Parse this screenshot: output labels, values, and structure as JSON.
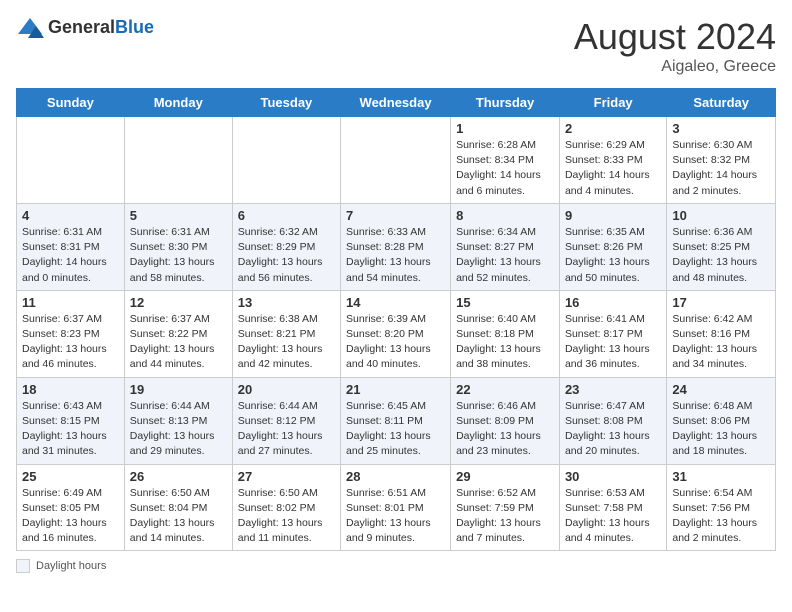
{
  "header": {
    "logo_general": "General",
    "logo_blue": "Blue",
    "title": "August 2024",
    "location": "Aigaleo, Greece"
  },
  "weekdays": [
    "Sunday",
    "Monday",
    "Tuesday",
    "Wednesday",
    "Thursday",
    "Friday",
    "Saturday"
  ],
  "weeks": [
    [
      {
        "day": "",
        "info": ""
      },
      {
        "day": "",
        "info": ""
      },
      {
        "day": "",
        "info": ""
      },
      {
        "day": "",
        "info": ""
      },
      {
        "day": "1",
        "info": "Sunrise: 6:28 AM\nSunset: 8:34 PM\nDaylight: 14 hours\nand 6 minutes."
      },
      {
        "day": "2",
        "info": "Sunrise: 6:29 AM\nSunset: 8:33 PM\nDaylight: 14 hours\nand 4 minutes."
      },
      {
        "day": "3",
        "info": "Sunrise: 6:30 AM\nSunset: 8:32 PM\nDaylight: 14 hours\nand 2 minutes."
      }
    ],
    [
      {
        "day": "4",
        "info": "Sunrise: 6:31 AM\nSunset: 8:31 PM\nDaylight: 14 hours\nand 0 minutes."
      },
      {
        "day": "5",
        "info": "Sunrise: 6:31 AM\nSunset: 8:30 PM\nDaylight: 13 hours\nand 58 minutes."
      },
      {
        "day": "6",
        "info": "Sunrise: 6:32 AM\nSunset: 8:29 PM\nDaylight: 13 hours\nand 56 minutes."
      },
      {
        "day": "7",
        "info": "Sunrise: 6:33 AM\nSunset: 8:28 PM\nDaylight: 13 hours\nand 54 minutes."
      },
      {
        "day": "8",
        "info": "Sunrise: 6:34 AM\nSunset: 8:27 PM\nDaylight: 13 hours\nand 52 minutes."
      },
      {
        "day": "9",
        "info": "Sunrise: 6:35 AM\nSunset: 8:26 PM\nDaylight: 13 hours\nand 50 minutes."
      },
      {
        "day": "10",
        "info": "Sunrise: 6:36 AM\nSunset: 8:25 PM\nDaylight: 13 hours\nand 48 minutes."
      }
    ],
    [
      {
        "day": "11",
        "info": "Sunrise: 6:37 AM\nSunset: 8:23 PM\nDaylight: 13 hours\nand 46 minutes."
      },
      {
        "day": "12",
        "info": "Sunrise: 6:37 AM\nSunset: 8:22 PM\nDaylight: 13 hours\nand 44 minutes."
      },
      {
        "day": "13",
        "info": "Sunrise: 6:38 AM\nSunset: 8:21 PM\nDaylight: 13 hours\nand 42 minutes."
      },
      {
        "day": "14",
        "info": "Sunrise: 6:39 AM\nSunset: 8:20 PM\nDaylight: 13 hours\nand 40 minutes."
      },
      {
        "day": "15",
        "info": "Sunrise: 6:40 AM\nSunset: 8:18 PM\nDaylight: 13 hours\nand 38 minutes."
      },
      {
        "day": "16",
        "info": "Sunrise: 6:41 AM\nSunset: 8:17 PM\nDaylight: 13 hours\nand 36 minutes."
      },
      {
        "day": "17",
        "info": "Sunrise: 6:42 AM\nSunset: 8:16 PM\nDaylight: 13 hours\nand 34 minutes."
      }
    ],
    [
      {
        "day": "18",
        "info": "Sunrise: 6:43 AM\nSunset: 8:15 PM\nDaylight: 13 hours\nand 31 minutes."
      },
      {
        "day": "19",
        "info": "Sunrise: 6:44 AM\nSunset: 8:13 PM\nDaylight: 13 hours\nand 29 minutes."
      },
      {
        "day": "20",
        "info": "Sunrise: 6:44 AM\nSunset: 8:12 PM\nDaylight: 13 hours\nand 27 minutes."
      },
      {
        "day": "21",
        "info": "Sunrise: 6:45 AM\nSunset: 8:11 PM\nDaylight: 13 hours\nand 25 minutes."
      },
      {
        "day": "22",
        "info": "Sunrise: 6:46 AM\nSunset: 8:09 PM\nDaylight: 13 hours\nand 23 minutes."
      },
      {
        "day": "23",
        "info": "Sunrise: 6:47 AM\nSunset: 8:08 PM\nDaylight: 13 hours\nand 20 minutes."
      },
      {
        "day": "24",
        "info": "Sunrise: 6:48 AM\nSunset: 8:06 PM\nDaylight: 13 hours\nand 18 minutes."
      }
    ],
    [
      {
        "day": "25",
        "info": "Sunrise: 6:49 AM\nSunset: 8:05 PM\nDaylight: 13 hours\nand 16 minutes."
      },
      {
        "day": "26",
        "info": "Sunrise: 6:50 AM\nSunset: 8:04 PM\nDaylight: 13 hours\nand 14 minutes."
      },
      {
        "day": "27",
        "info": "Sunrise: 6:50 AM\nSunset: 8:02 PM\nDaylight: 13 hours\nand 11 minutes."
      },
      {
        "day": "28",
        "info": "Sunrise: 6:51 AM\nSunset: 8:01 PM\nDaylight: 13 hours\nand 9 minutes."
      },
      {
        "day": "29",
        "info": "Sunrise: 6:52 AM\nSunset: 7:59 PM\nDaylight: 13 hours\nand 7 minutes."
      },
      {
        "day": "30",
        "info": "Sunrise: 6:53 AM\nSunset: 7:58 PM\nDaylight: 13 hours\nand 4 minutes."
      },
      {
        "day": "31",
        "info": "Sunrise: 6:54 AM\nSunset: 7:56 PM\nDaylight: 13 hours\nand 2 minutes."
      }
    ]
  ],
  "footer": {
    "label": "Daylight hours"
  }
}
